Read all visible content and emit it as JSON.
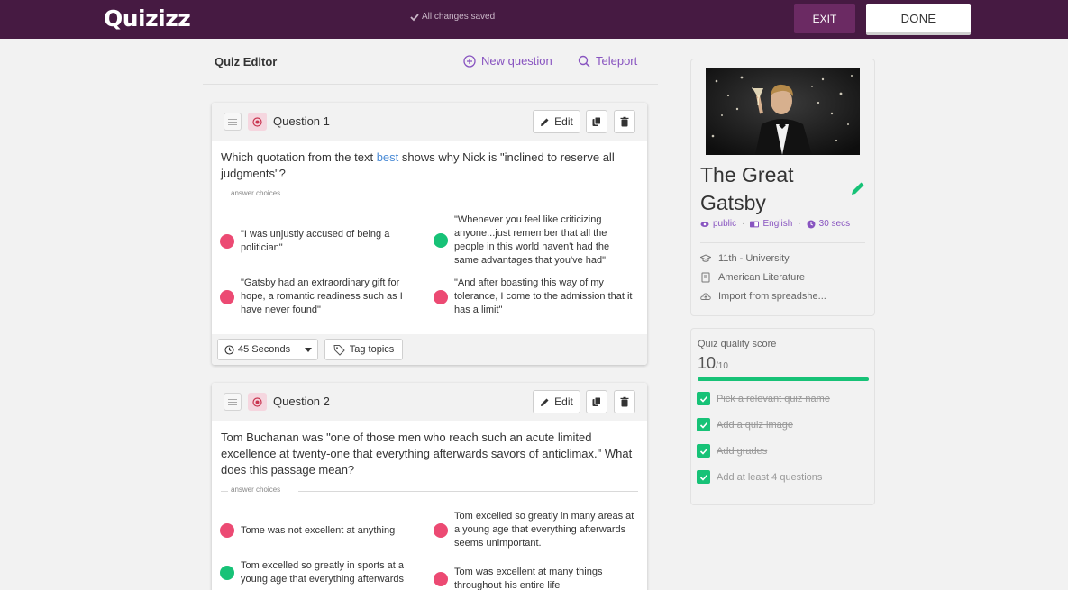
{
  "topbar": {
    "logo": "Quizizz",
    "saved_status": "All changes saved",
    "exit_label": "EXIT",
    "done_label": "DONE"
  },
  "editor": {
    "title": "Quiz Editor",
    "new_question_label": "New question",
    "teleport_label": "Teleport"
  },
  "questions": [
    {
      "number_label": "Question 1",
      "edit_label": "Edit",
      "text_before": "Which quotation from the text ",
      "text_highlight": "best",
      "text_after": " shows why Nick is \"inclined to reserve all judgments\"?",
      "answer_choices_label": "answer choices",
      "choices": [
        {
          "text": "\"I was unjustly accused of being a politician\"",
          "correct": false
        },
        {
          "text": "\"Whenever you feel like criticizing anyone...just remember that all the people in this world haven't had the same advantages that you've had\"",
          "correct": true
        },
        {
          "text": "\"Gatsby had an extraordinary gift for hope, a romantic readiness such as I have never found\"",
          "correct": false
        },
        {
          "text": "\"And after boasting this way of my tolerance, I come to the admission that it has a limit\"",
          "correct": false
        }
      ],
      "time_label": "45 Seconds",
      "tag_label": "Tag topics"
    },
    {
      "number_label": "Question 2",
      "edit_label": "Edit",
      "text": "Tom Buchanan was \"one of those men who reach such an acute limited excellence at twenty-one that everything afterwards savors of anticlimax.\" What does this passage mean?",
      "answer_choices_label": "answer choices",
      "choices": [
        {
          "text": "Tome was not excellent at anything",
          "correct": false
        },
        {
          "text": "Tom excelled so greatly in many areas at a young age that everything afterwards seems unimportant.",
          "correct": false
        },
        {
          "text": "Tom excelled so greatly in sports at a young age that everything afterwards",
          "correct": true
        },
        {
          "text": "Tom was excellent at many things throughout his entire life",
          "correct": false
        }
      ]
    }
  ],
  "quiz": {
    "name": "The Great Gatsby",
    "visibility": "public",
    "language": "English",
    "time": "30 secs",
    "grade": "11th - University",
    "subject": "American Literature",
    "import_label": "Import from spreadshe..."
  },
  "quality": {
    "title": "Quiz quality score",
    "score": "10",
    "max": "/10",
    "fill_fraction": 1.0,
    "checks": [
      "Pick a relevant quiz name",
      "Add a quiz image",
      "Add grades",
      "Add at least 4 questions"
    ]
  },
  "colors": {
    "brand_purple": "#461a42",
    "accent_purple": "#8854c0",
    "correct_green": "#17c277",
    "wrong_pink": "#ec4a73"
  }
}
